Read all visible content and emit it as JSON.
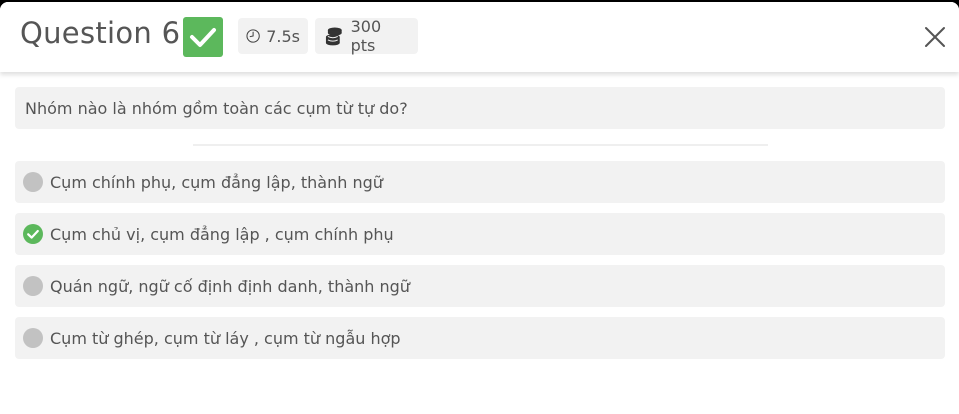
{
  "header": {
    "title": "Question 6",
    "timer": "7.5s",
    "points": "300 pts",
    "status_icon": "check-icon",
    "status_color": "#5cb85c"
  },
  "question": {
    "text": "Nhóm nào là nhóm gồm toàn các cụm từ tự do?"
  },
  "options": [
    {
      "label": "Cụm chính phụ, cụm đẳng lập, thành ngữ",
      "selected": false
    },
    {
      "label": "Cụm chủ vị, cụm đẳng lập , cụm chính phụ",
      "selected": true
    },
    {
      "label": "Quán ngữ, ngữ cố định định danh, thành ngữ",
      "selected": false
    },
    {
      "label": "Cụm từ ghép, cụm từ láy , cụm từ ngẫu hợp",
      "selected": false
    }
  ],
  "colors": {
    "correct": "#5cb85c",
    "unselected_dot": "#c2c2c2",
    "chip_bg": "#f2f2f2"
  }
}
